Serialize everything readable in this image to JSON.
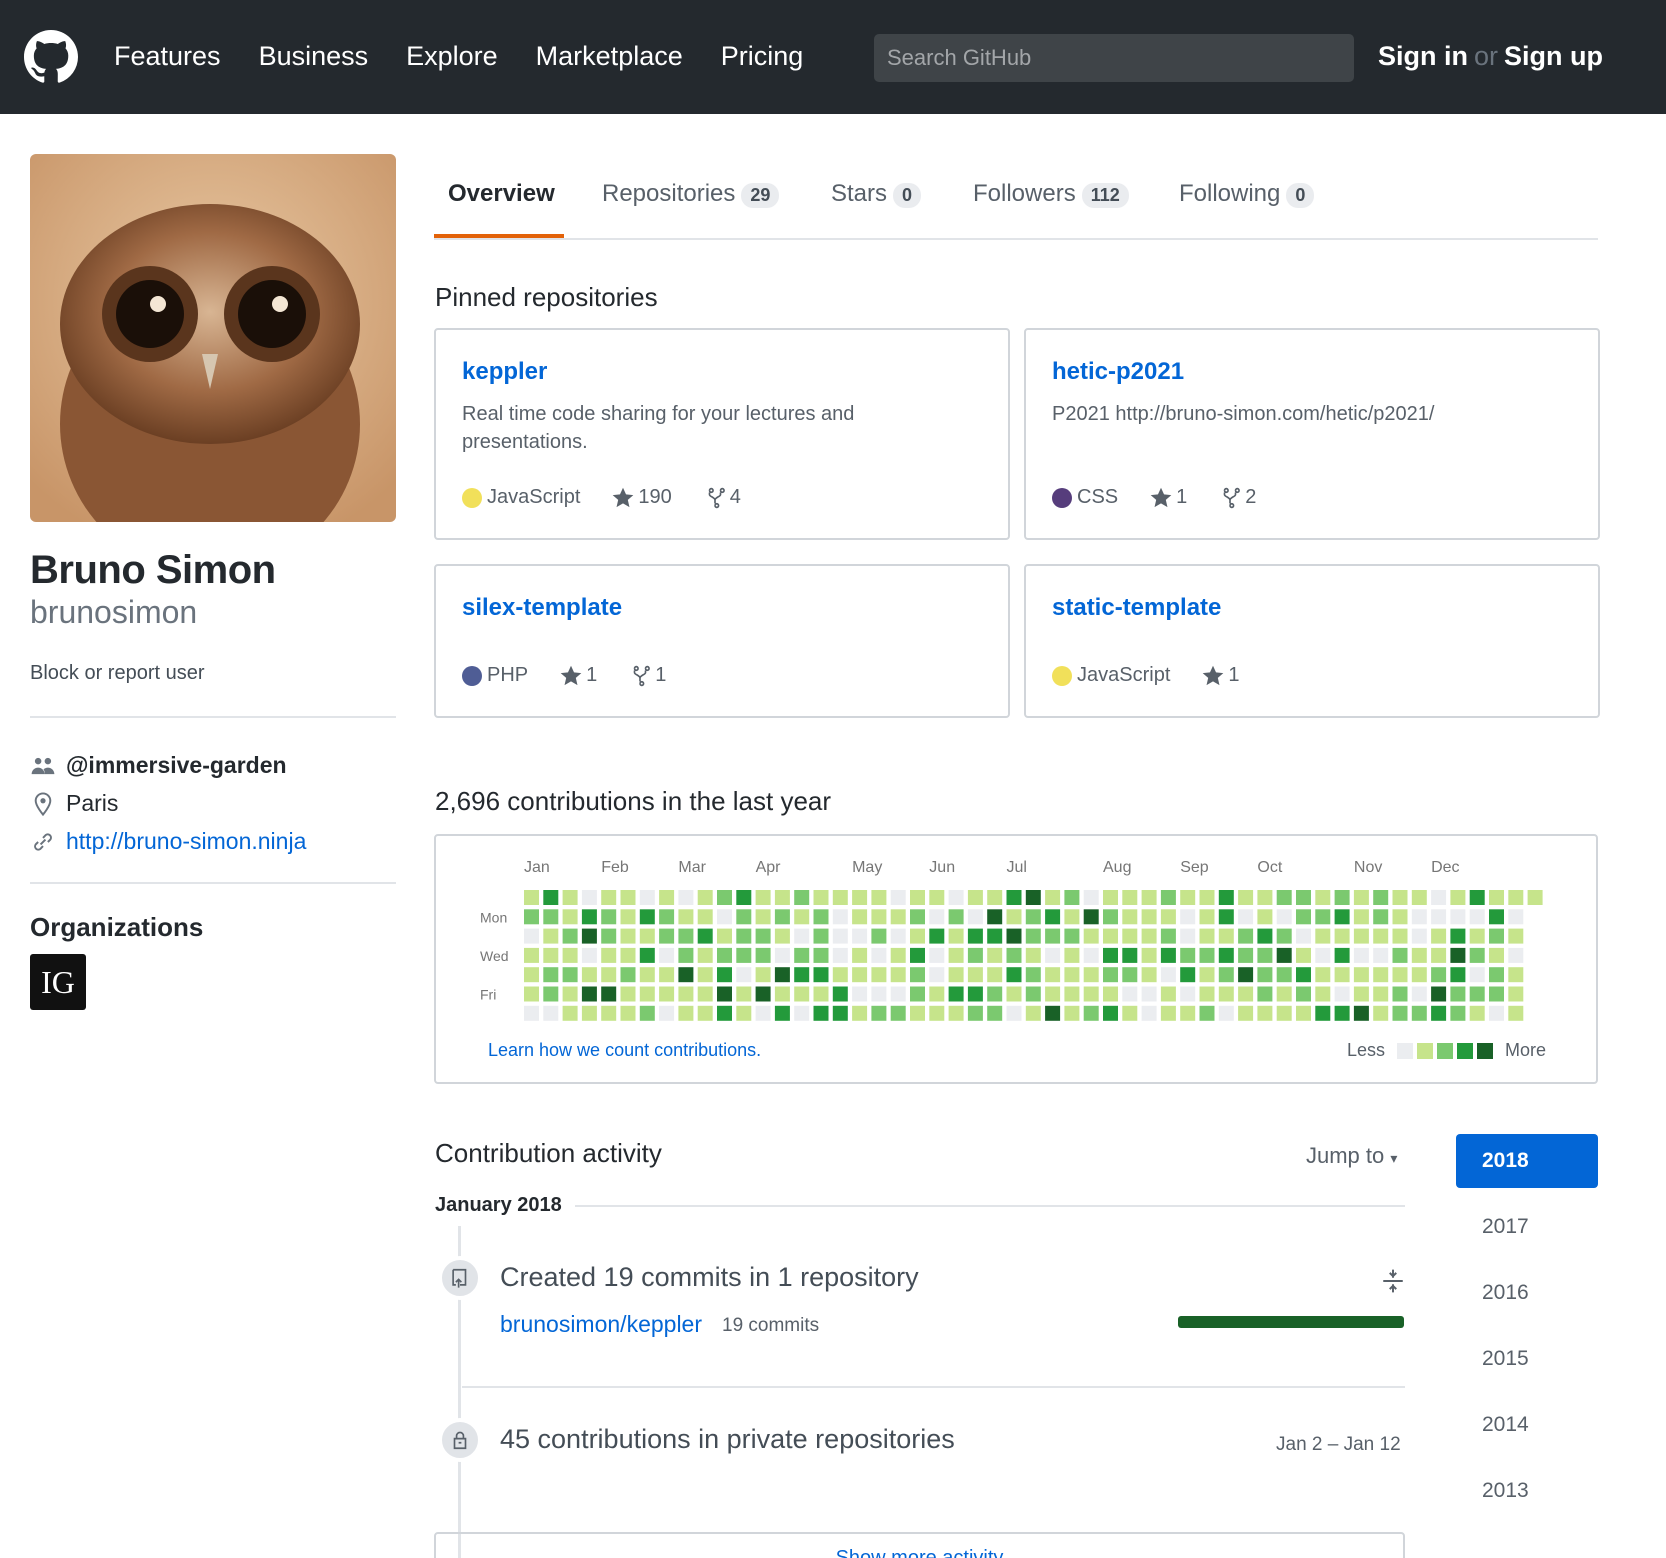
{
  "header": {
    "nav": [
      "Features",
      "Business",
      "Explore",
      "Marketplace",
      "Pricing"
    ],
    "search_placeholder": "Search GitHub",
    "sign_in": "Sign in",
    "or": "or",
    "sign_up": "Sign up",
    "logo_icon": "github-octocat-icon"
  },
  "profile": {
    "fullname": "Bruno Simon",
    "username": "brunosimon",
    "block": "Block or report user",
    "organization": "@immersive-garden",
    "location": "Paris",
    "website": "http://bruno-simon.ninja",
    "orgs_title": "Organizations",
    "org_badge": "IG"
  },
  "tabs": [
    {
      "label": "Overview",
      "count": null
    },
    {
      "label": "Repositories",
      "count": "29"
    },
    {
      "label": "Stars",
      "count": "0"
    },
    {
      "label": "Followers",
      "count": "112"
    },
    {
      "label": "Following",
      "count": "0"
    }
  ],
  "pinned": {
    "title": "Pinned repositories",
    "repos": [
      {
        "name": "keppler",
        "desc": "Real time code sharing for your lectures and presentations.",
        "lang": "JavaScript",
        "lang_color": "#f1e05a",
        "stars": "190",
        "forks": "4"
      },
      {
        "name": "hetic-p2021",
        "desc": "P2021 http://bruno-simon.com/hetic/p2021/",
        "lang": "CSS",
        "lang_color": "#563d7c",
        "stars": "1",
        "forks": "2"
      },
      {
        "name": "silex-template",
        "desc": "",
        "lang": "PHP",
        "lang_color": "#4F5D95",
        "stars": "1",
        "forks": "1"
      },
      {
        "name": "static-template",
        "desc": "",
        "lang": "JavaScript",
        "lang_color": "#f1e05a",
        "stars": "1",
        "forks": null
      }
    ]
  },
  "contributions": {
    "title": "2,696 contributions in the last year",
    "months": [
      "Jan",
      "Feb",
      "Mar",
      "Apr",
      "May",
      "Jun",
      "Jul",
      "Aug",
      "Sep",
      "Oct",
      "Nov",
      "Dec"
    ],
    "days": [
      "Mon",
      "Wed",
      "Fri"
    ],
    "learn": "Learn how we count contributions.",
    "less": "Less",
    "more": "More",
    "colors": [
      "#ebedf0",
      "#c6e48b",
      "#7bc96f",
      "#239a3b",
      "#196127"
    ]
  },
  "activity": {
    "title": "Contribution activity",
    "jump": "Jump to",
    "month": "January 2018",
    "created": "Created 19 commits in 1 repository",
    "repo": "brunosimon/keppler",
    "commits": "19 commits",
    "private": "45 contributions in private repositories",
    "private_dates": "Jan 2 – Jan 12",
    "show_more": "Show more activity",
    "years": [
      "2018",
      "2017",
      "2016",
      "2015",
      "2014",
      "2013"
    ]
  }
}
